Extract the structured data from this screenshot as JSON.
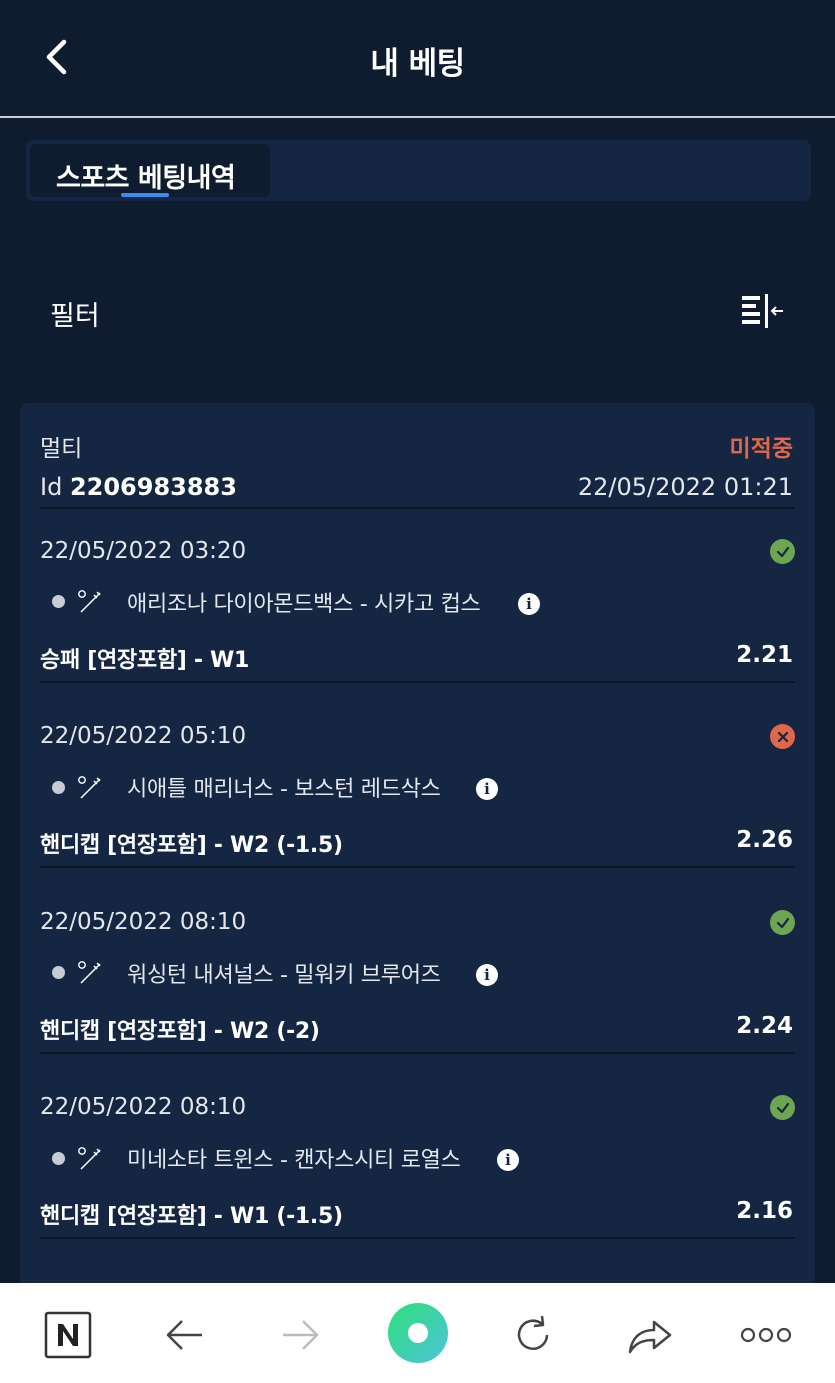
{
  "header": {
    "title": "내 베팅"
  },
  "tabs": [
    {
      "label": "스포츠 베팅내역"
    }
  ],
  "filter": {
    "label": "필터"
  },
  "bet": {
    "type": "멀티",
    "status": "미적중",
    "id_label": "Id",
    "id_value": "2206983883",
    "datetime": "22/05/2022 01:21",
    "colors": {
      "won": "#6ea553",
      "lost": "#e0674a",
      "status_text": "#e0674a"
    },
    "selections": [
      {
        "time": "22/05/2022 03:20",
        "result_icon": "check-icon",
        "sport_icon": "baseball-icon",
        "match": "애리조나 다이아몬드백스 - 시카고 컵스",
        "market": "승패 [연장포함] - W1",
        "odds": "2.21"
      },
      {
        "time": "22/05/2022 05:10",
        "result_icon": "cross-icon",
        "sport_icon": "baseball-icon",
        "match": "시애틀 매리너스 - 보스턴 레드삭스",
        "market": "핸디캡 [연장포함] - W2 (-1.5)",
        "odds": "2.26"
      },
      {
        "time": "22/05/2022 08:10",
        "result_icon": "check-icon",
        "sport_icon": "baseball-icon",
        "match": "워싱턴 내셔널스 - 밀워키 브루어즈",
        "market": "핸디캡 [연장포함] - W2 (-2)",
        "odds": "2.24"
      },
      {
        "time": "22/05/2022 08:10",
        "result_icon": "check-icon",
        "sport_icon": "baseball-icon",
        "match": "미네소타 트윈스 - 캔자스시티 로열스",
        "market": "핸디캡 [연장포함] - W1 (-1.5)",
        "odds": "2.16"
      }
    ]
  },
  "browser_bar": {
    "icons": [
      "naver-icon",
      "back-arrow-icon",
      "forward-arrow-icon",
      "home-circle-icon",
      "refresh-icon",
      "share-icon",
      "more-icon"
    ]
  }
}
